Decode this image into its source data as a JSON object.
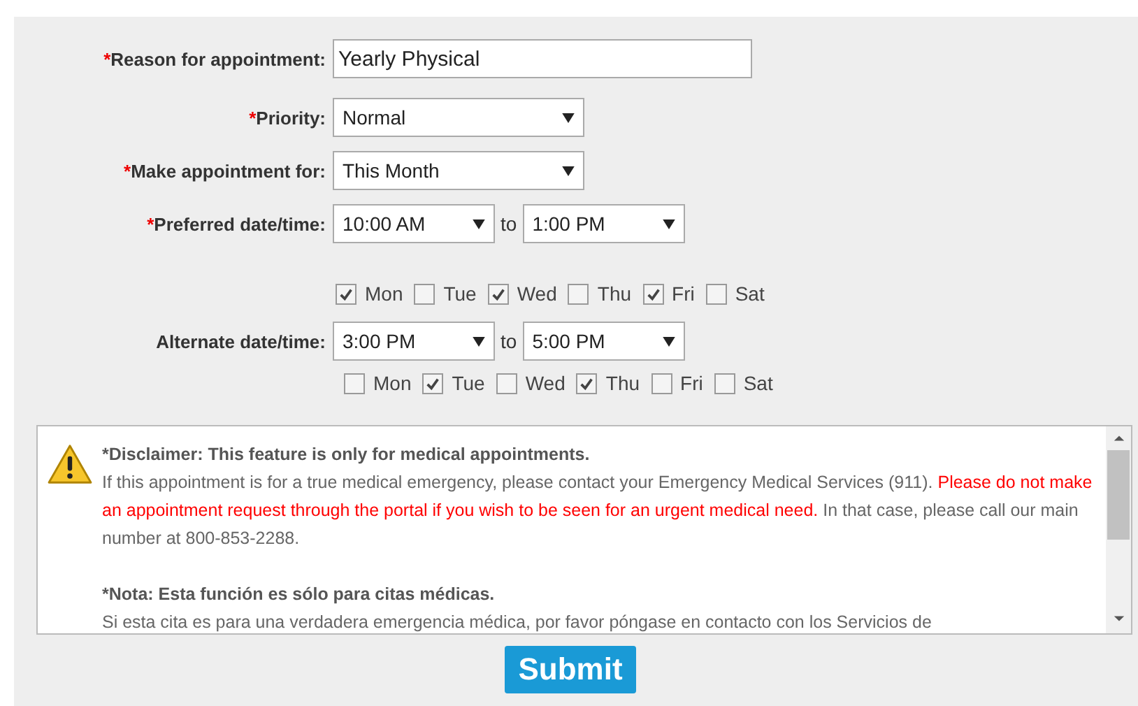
{
  "form": {
    "fields": [
      {
        "kind": "text",
        "label": "Reason for appointment:",
        "mark": "*",
        "value": "Yearly Physical"
      },
      {
        "kind": "select",
        "label": "Priority:",
        "mark": "*",
        "value": "Normal"
      },
      {
        "kind": "select",
        "label": "Make appointment for:",
        "mark": "*",
        "value": "This Month"
      },
      {
        "kind": "range",
        "label": "Preferred date/time:",
        "mark": "*",
        "from": "10:00 AM",
        "joiner": "to",
        "to": "1:00 PM",
        "days": [
          {
            "label": "Mon",
            "checked": true
          },
          {
            "label": "Tue",
            "checked": false
          },
          {
            "label": "Wed",
            "checked": true
          },
          {
            "label": "Thu",
            "checked": false
          },
          {
            "label": "Fri",
            "checked": true
          },
          {
            "label": "Sat",
            "checked": false
          }
        ]
      },
      {
        "kind": "range",
        "label": "Alternate date/time:",
        "from": "3:00 PM",
        "joiner": "to",
        "to": "5:00 PM",
        "days": [
          {
            "label": "Mon",
            "checked": false
          },
          {
            "label": "Tue",
            "checked": true
          },
          {
            "label": "Wed",
            "checked": false
          },
          {
            "label": "Thu",
            "checked": true
          },
          {
            "label": "Fri",
            "checked": false
          },
          {
            "label": "Sat",
            "checked": false
          }
        ]
      }
    ]
  },
  "disclaimer": {
    "paragraphs": [
      {
        "kind": "heading",
        "segments": [
          {
            "kind": "normal",
            "text": "*Disclaimer: This feature is only for medical appointments."
          }
        ]
      },
      {
        "kind": "body",
        "segments": [
          {
            "kind": "normal",
            "text": "If this appointment is for a true medical emergency, please contact your Emergency Medical Services (911). "
          },
          {
            "kind": "urgent",
            "text": "Please do not make an appointment request through the portal if you wish to be seen for an urgent medical need."
          },
          {
            "kind": "normal",
            "text": " In that case, please call our main number at 800-853-2288."
          }
        ]
      },
      {
        "kind": "heading",
        "segments": [
          {
            "kind": "normal",
            "text": "*Nota: Esta función es sólo para citas médicas."
          }
        ]
      },
      {
        "kind": "body",
        "segments": [
          {
            "kind": "normal",
            "text": "Si esta cita es para una verdadera emergencia médica, por favor póngase en contacto con los Servicios de"
          }
        ]
      }
    ]
  },
  "submit": {
    "label": "Submit"
  }
}
